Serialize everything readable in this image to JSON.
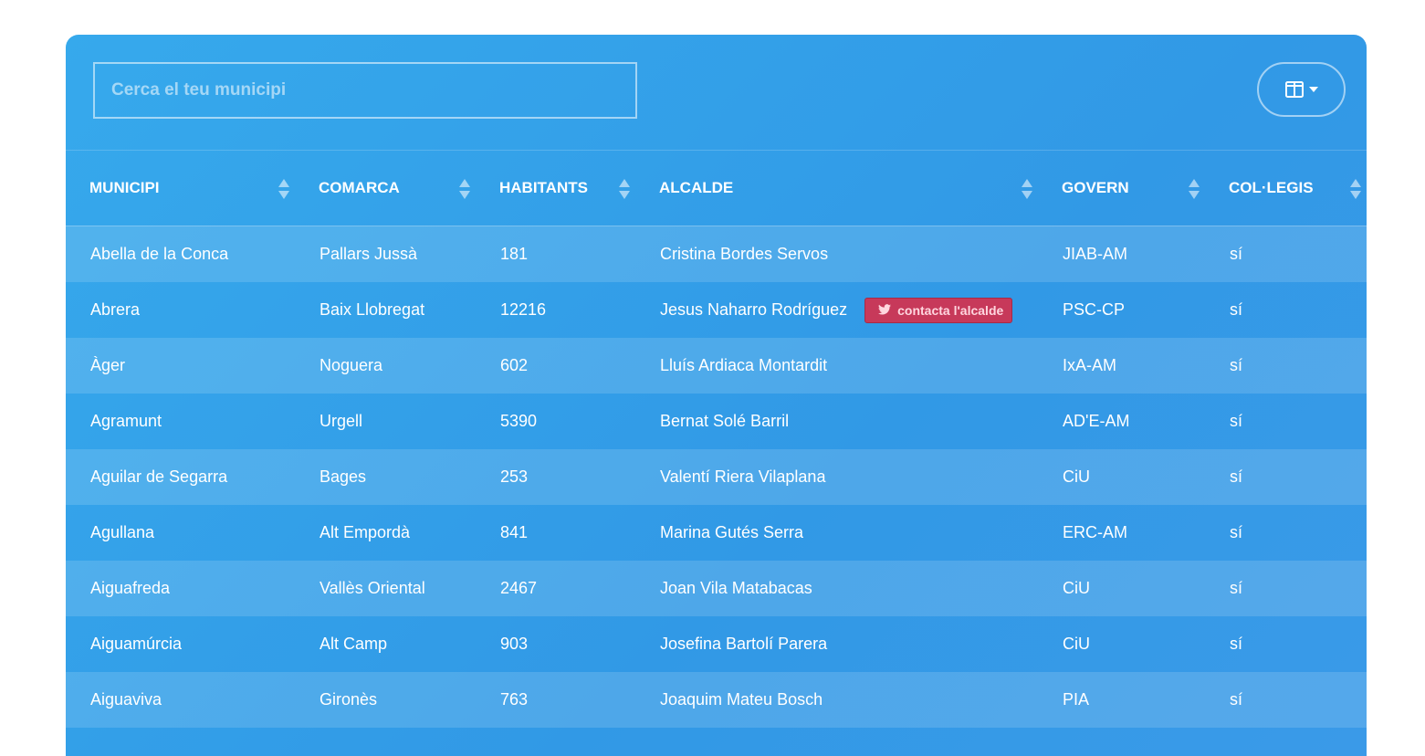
{
  "search": {
    "placeholder": "Cerca el teu municipi"
  },
  "toolbar": {
    "columns_icon": "columns-icon",
    "dropdown_icon": "caret-down-icon"
  },
  "table": {
    "headers": [
      "MUNICIPI",
      "COMARCA",
      "HABITANTS",
      "ALCALDE",
      "GOVERN",
      "COL·LEGIS"
    ],
    "rows": [
      [
        "Abella de la Conca",
        "Pallars Jussà",
        "181",
        "Cristina Bordes Servos",
        "JIAB-AM",
        "sí"
      ],
      [
        "Abrera",
        "Baix Llobregat",
        "12216",
        "Jesus Naharro Rodríguez",
        "PSC-CP",
        "sí"
      ],
      [
        "Àger",
        "Noguera",
        "602",
        "Lluís Ardiaca Montardit",
        "IxA-AM",
        "sí"
      ],
      [
        "Agramunt",
        "Urgell",
        "5390",
        "Bernat Solé Barril",
        "AD'E-AM",
        "sí"
      ],
      [
        "Aguilar de Segarra",
        "Bages",
        "253",
        "Valentí Riera Vilaplana",
        "CiU",
        "sí"
      ],
      [
        "Agullana",
        "Alt Empordà",
        "841",
        "Marina Gutés Serra",
        "ERC-AM",
        "sí"
      ],
      [
        "Aiguafreda",
        "Vallès Oriental",
        "2467",
        "Joan Vila Matabacas",
        "CiU",
        "sí"
      ],
      [
        "Aiguamúrcia",
        "Alt Camp",
        "903",
        "Josefina Bartolí Parera",
        "CiU",
        "sí"
      ],
      [
        "Aiguaviva",
        "Gironès",
        "763",
        "Joaquim Mateu Bosch",
        "PIA",
        "sí"
      ]
    ],
    "contact_badge": {
      "label": "contacta l'alcalde",
      "icon": "twitter-icon",
      "color": "#c7395a"
    }
  },
  "colors": {
    "accent": "#36a9ec",
    "badge": "#c7395a"
  }
}
